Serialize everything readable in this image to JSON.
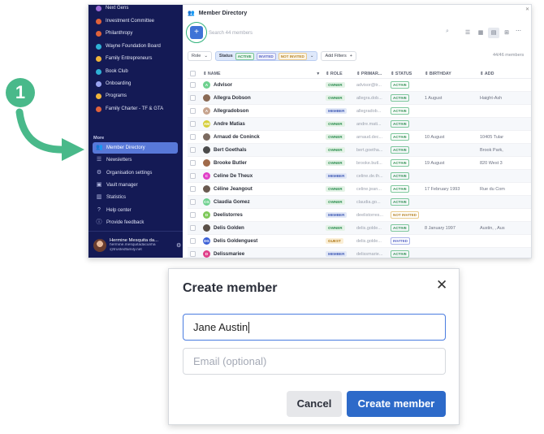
{
  "sidebar": {
    "teams": [
      {
        "label": "Next Gens",
        "color": "#9b6bd6"
      },
      {
        "label": "Investment Committee",
        "color": "#e0623b"
      },
      {
        "label": "Philanthropy",
        "color": "#e0623b"
      },
      {
        "label": "Wayne Foundation Board",
        "color": "#2fb1d6"
      },
      {
        "label": "Family Entrepreneurs",
        "color": "#f0b43a"
      },
      {
        "label": "Book Club",
        "color": "#2fb1d6"
      },
      {
        "label": "Onboarding",
        "color": "#9aa4f0"
      },
      {
        "label": "Programs",
        "color": "#f0b43a"
      },
      {
        "label": "Family Charter - TF & GTA",
        "color": "#e0623b"
      }
    ],
    "more_label": "More",
    "nav": [
      {
        "label": "Member Directory",
        "icon": "people-icon",
        "active": true
      },
      {
        "label": "Newsletters",
        "icon": "newsletter-icon"
      },
      {
        "label": "Organisation settings",
        "icon": "gear-icon"
      },
      {
        "label": "Vault manager",
        "icon": "vault-icon"
      },
      {
        "label": "Statistics",
        "icon": "chart-icon"
      },
      {
        "label": "Help center",
        "icon": "help-icon"
      },
      {
        "label": "Provide feedback",
        "icon": "info-icon"
      }
    ],
    "user": {
      "name": "Hermine Mesquita da...",
      "email_line1": "hermine.mesquitadacunha",
      "email_line2": "@trustedfamily.net"
    }
  },
  "main": {
    "title": "Member Directory",
    "search_placeholder": "Search 44 members",
    "filters": {
      "role_label": "Role",
      "status_label": "Status",
      "status_tags": [
        "ACTIVE",
        "INVITED",
        "NOT INVITED"
      ],
      "add_filters_label": "Add Filters"
    },
    "count": "44/46 members",
    "columns": {
      "name": "NAME",
      "role": "ROLE",
      "primary": "PRIMAR...",
      "status": "STATUS",
      "birthday": "BIRTHDAY",
      "address": "ADD"
    },
    "rows": [
      {
        "name": "Advisor",
        "avatar": "A",
        "avatar_color": "#6fd18f",
        "role": "OWNER",
        "primary": "advisor@tr...",
        "status": "ACTIVE",
        "birthday": "",
        "address": ""
      },
      {
        "name": "Allegra Dobson",
        "avatar": "",
        "avatar_color": "#8a6a55",
        "role": "OWNER",
        "primary": "allegra.dob...",
        "status": "ACTIVE",
        "birthday": "1 August",
        "address": "Haight-Ash"
      },
      {
        "name": "Allegradobson",
        "avatar": "A",
        "avatar_color": "#c7a48e",
        "role": "MEMBER",
        "primary": "allegradob...",
        "status": "ACTIVE",
        "birthday": "",
        "address": ""
      },
      {
        "name": "Andre Matias",
        "avatar": "AM",
        "avatar_color": "#d6cf3a",
        "role": "OWNER",
        "primary": "andre.mati...",
        "status": "ACTIVE",
        "birthday": "",
        "address": ""
      },
      {
        "name": "Arnaud de Coninck",
        "avatar": "",
        "avatar_color": "#7b6a60",
        "role": "OWNER",
        "primary": "arnaud.dec...",
        "status": "ACTIVE",
        "birthday": "10 August",
        "address": "10405 Tular"
      },
      {
        "name": "Bert Goethals",
        "avatar": "",
        "avatar_color": "#4b4b4b",
        "role": "OWNER",
        "primary": "bert.goetha...",
        "status": "ACTIVE",
        "birthday": "",
        "address": "Brook Park,"
      },
      {
        "name": "Brooke Butler",
        "avatar": "",
        "avatar_color": "#a06a4a",
        "role": "OWNER",
        "primary": "brooke.butl...",
        "status": "ACTIVE",
        "birthday": "19 August",
        "address": "820 West 3"
      },
      {
        "name": "Celine De Theux",
        "avatar": "C",
        "avatar_color": "#e040c8",
        "role": "MEMBER",
        "primary": "celine.de.th...",
        "status": "ACTIVE",
        "birthday": "",
        "address": ""
      },
      {
        "name": "Céline Jeangout",
        "avatar": "",
        "avatar_color": "#6a5a50",
        "role": "OWNER",
        "primary": "celine.jean...",
        "status": "ACTIVE",
        "birthday": "17 February 1993",
        "address": "Rue du Com"
      },
      {
        "name": "Claudia Gomez",
        "avatar": "CG",
        "avatar_color": "#6fd18f",
        "role": "OWNER",
        "primary": "claudia.go...",
        "status": "ACTIVE",
        "birthday": "",
        "address": ""
      },
      {
        "name": "Deelistorres",
        "avatar": "D",
        "avatar_color": "#7fc95a",
        "role": "MEMBER",
        "primary": "deelistorres...",
        "status": "NOT INVITED",
        "birthday": "",
        "address": ""
      },
      {
        "name": "Delis Golden",
        "avatar": "",
        "avatar_color": "#5a5048",
        "role": "OWNER",
        "primary": "delis.golde...",
        "status": "ACTIVE",
        "birthday": "8 January 1997",
        "address": "Austin, , Aus"
      },
      {
        "name": "Delis Goldenguest",
        "avatar": "DG",
        "avatar_color": "#3a5fd6",
        "role": "GUEST",
        "primary": "delis.golde...",
        "status": "INVITED",
        "birthday": "",
        "address": ""
      },
      {
        "name": "Delissmariee",
        "avatar": "D",
        "avatar_color": "#e0408a",
        "role": "MEMBER",
        "primary": "delissmarie...",
        "status": "ACTIVE",
        "birthday": "",
        "address": ""
      }
    ]
  },
  "callout": {
    "step_number": "1",
    "accent_color": "#49b98a"
  },
  "dialog": {
    "title": "Create member",
    "name_value": "Jane Austin",
    "email_placeholder": "Email (optional)",
    "cancel_label": "Cancel",
    "create_label": "Create member"
  }
}
